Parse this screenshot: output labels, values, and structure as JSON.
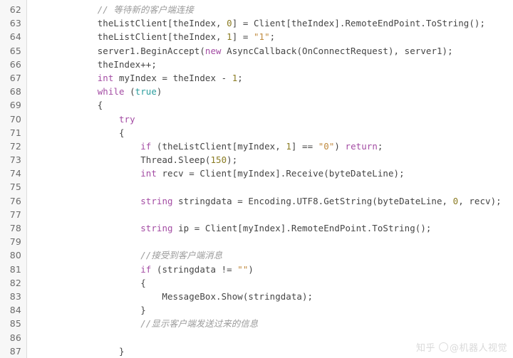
{
  "editor": {
    "language": "csharp",
    "first_line_number": 62,
    "background_color": "#ffffff",
    "gutter_background_color": "#f7f7f7",
    "gutter_text_color": "#6b6b6b",
    "default_text_color": "#444444",
    "syntax_colors": {
      "keyword": "#a34ba3",
      "type": "#a34ba3",
      "literal": "#2a9d9d",
      "string": "#c08a3e",
      "number": "#8a7b22",
      "comment": "#9b9b9b"
    }
  },
  "lines": [
    {
      "number": "62",
      "tokens": [
        {
          "t": "            ",
          "c": "plain"
        },
        {
          "t": "// 等待新的客户端连接",
          "c": "comment"
        }
      ]
    },
    {
      "number": "63",
      "tokens": [
        {
          "t": "            theListClient[theIndex, ",
          "c": "plain"
        },
        {
          "t": "0",
          "c": "number"
        },
        {
          "t": "] = Client[theIndex].RemoteEndPoint.ToString();",
          "c": "plain"
        }
      ]
    },
    {
      "number": "64",
      "tokens": [
        {
          "t": "            theListClient[theIndex, ",
          "c": "plain"
        },
        {
          "t": "1",
          "c": "number"
        },
        {
          "t": "] = ",
          "c": "plain"
        },
        {
          "t": "\"1\"",
          "c": "string"
        },
        {
          "t": ";",
          "c": "plain"
        }
      ]
    },
    {
      "number": "65",
      "tokens": [
        {
          "t": "            server1.BeginAccept(",
          "c": "plain"
        },
        {
          "t": "new",
          "c": "keyword"
        },
        {
          "t": " AsyncCallback(OnConnectRequest), server1);",
          "c": "plain"
        }
      ]
    },
    {
      "number": "66",
      "tokens": [
        {
          "t": "            theIndex++;",
          "c": "plain"
        }
      ]
    },
    {
      "number": "67",
      "tokens": [
        {
          "t": "            ",
          "c": "plain"
        },
        {
          "t": "int",
          "c": "type"
        },
        {
          "t": " myIndex = theIndex - ",
          "c": "plain"
        },
        {
          "t": "1",
          "c": "number"
        },
        {
          "t": ";",
          "c": "plain"
        }
      ]
    },
    {
      "number": "68",
      "tokens": [
        {
          "t": "            ",
          "c": "plain"
        },
        {
          "t": "while",
          "c": "keyword"
        },
        {
          "t": " (",
          "c": "plain"
        },
        {
          "t": "true",
          "c": "literal"
        },
        {
          "t": ")",
          "c": "plain"
        }
      ]
    },
    {
      "number": "69",
      "tokens": [
        {
          "t": "            {",
          "c": "plain"
        }
      ]
    },
    {
      "number": "70",
      "tokens": [
        {
          "t": "                ",
          "c": "plain"
        },
        {
          "t": "try",
          "c": "keyword"
        }
      ]
    },
    {
      "number": "71",
      "tokens": [
        {
          "t": "                {",
          "c": "plain"
        }
      ]
    },
    {
      "number": "72",
      "tokens": [
        {
          "t": "                    ",
          "c": "plain"
        },
        {
          "t": "if",
          "c": "keyword"
        },
        {
          "t": " (theListClient[myIndex, ",
          "c": "plain"
        },
        {
          "t": "1",
          "c": "number"
        },
        {
          "t": "] == ",
          "c": "plain"
        },
        {
          "t": "\"0\"",
          "c": "string"
        },
        {
          "t": ") ",
          "c": "plain"
        },
        {
          "t": "return",
          "c": "keyword"
        },
        {
          "t": ";",
          "c": "plain"
        }
      ]
    },
    {
      "number": "73",
      "tokens": [
        {
          "t": "                    Thread.Sleep(",
          "c": "plain"
        },
        {
          "t": "150",
          "c": "number"
        },
        {
          "t": ");",
          "c": "plain"
        }
      ]
    },
    {
      "number": "74",
      "tokens": [
        {
          "t": "                    ",
          "c": "plain"
        },
        {
          "t": "int",
          "c": "type"
        },
        {
          "t": " recv = Client[myIndex].Receive(byteDateLine);",
          "c": "plain"
        }
      ]
    },
    {
      "number": "75",
      "tokens": [
        {
          "t": "",
          "c": "plain"
        }
      ]
    },
    {
      "number": "76",
      "tokens": [
        {
          "t": "                    ",
          "c": "plain"
        },
        {
          "t": "string",
          "c": "type"
        },
        {
          "t": " stringdata = Encoding.UTF8.GetString(byteDateLine, ",
          "c": "plain"
        },
        {
          "t": "0",
          "c": "number"
        },
        {
          "t": ", recv);",
          "c": "plain"
        }
      ]
    },
    {
      "number": "77",
      "tokens": [
        {
          "t": "",
          "c": "plain"
        }
      ]
    },
    {
      "number": "78",
      "tokens": [
        {
          "t": "                    ",
          "c": "plain"
        },
        {
          "t": "string",
          "c": "type"
        },
        {
          "t": " ip = Client[myIndex].RemoteEndPoint.ToString();",
          "c": "plain"
        }
      ]
    },
    {
      "number": "79",
      "tokens": [
        {
          "t": "",
          "c": "plain"
        }
      ]
    },
    {
      "number": "80",
      "tokens": [
        {
          "t": "                    ",
          "c": "plain"
        },
        {
          "t": "//接受到客户端消息",
          "c": "comment"
        }
      ]
    },
    {
      "number": "81",
      "tokens": [
        {
          "t": "                    ",
          "c": "plain"
        },
        {
          "t": "if",
          "c": "keyword"
        },
        {
          "t": " (stringdata != ",
          "c": "plain"
        },
        {
          "t": "\"\"",
          "c": "string"
        },
        {
          "t": ")",
          "c": "plain"
        }
      ]
    },
    {
      "number": "82",
      "tokens": [
        {
          "t": "                    {",
          "c": "plain"
        }
      ]
    },
    {
      "number": "83",
      "tokens": [
        {
          "t": "                        MessageBox.Show(stringdata);",
          "c": "plain"
        }
      ]
    },
    {
      "number": "84",
      "tokens": [
        {
          "t": "                    }",
          "c": "plain"
        }
      ]
    },
    {
      "number": "85",
      "tokens": [
        {
          "t": "                    ",
          "c": "plain"
        },
        {
          "t": "//显示客户端发送过来的信息",
          "c": "comment"
        }
      ]
    },
    {
      "number": "86",
      "tokens": [
        {
          "t": "",
          "c": "plain"
        }
      ]
    },
    {
      "number": "87",
      "tokens": [
        {
          "t": "                }",
          "c": "plain"
        }
      ]
    }
  ],
  "watermark": {
    "brand": "知乎",
    "handle": "@机器人视觉"
  }
}
